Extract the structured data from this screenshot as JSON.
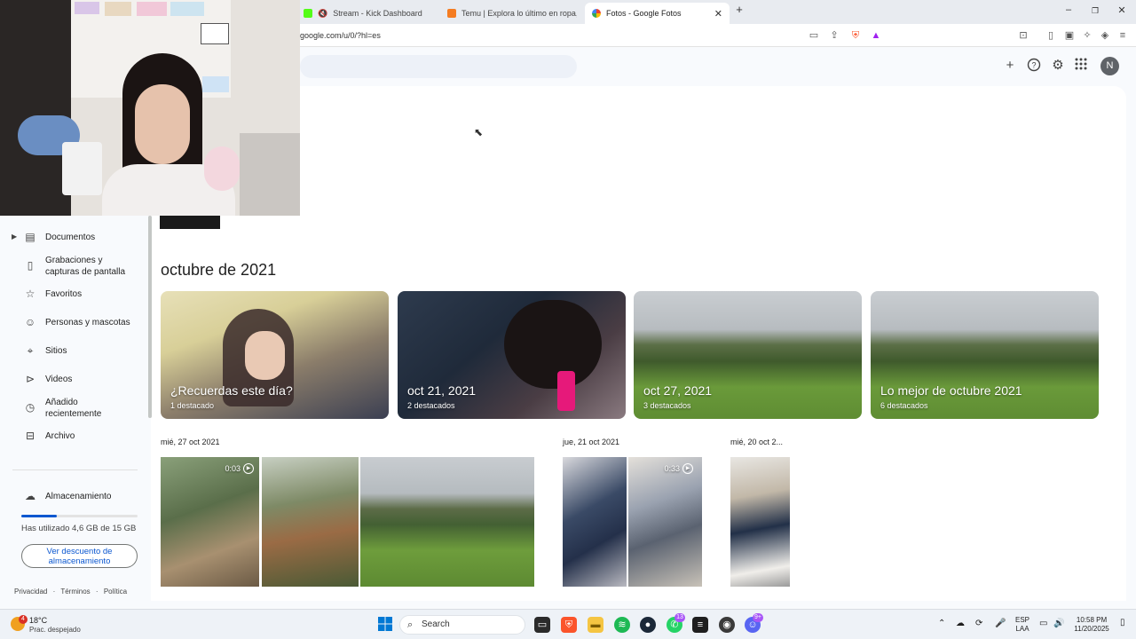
{
  "browser": {
    "tabs": [
      {
        "title": "Stream - Kick Dashboard",
        "active": false
      },
      {
        "title": "Temu | Explora lo último en ropa, be",
        "active": false
      },
      {
        "title": "Fotos - Google Fotos",
        "active": true
      }
    ],
    "url": "google.com/u/0/?hl=es"
  },
  "header": {
    "avatar_initial": "N"
  },
  "sidebar": {
    "items": [
      {
        "label": "Documentos",
        "icon": "document-icon"
      },
      {
        "label": "Grabaciones y capturas de pantalla",
        "icon": "screen-record-icon"
      },
      {
        "label": "Favoritos",
        "icon": "star-icon"
      },
      {
        "label": "Personas y mascotas",
        "icon": "face-icon"
      },
      {
        "label": "Sitios",
        "icon": "location-pin-icon"
      },
      {
        "label": "Videos",
        "icon": "play-icon"
      },
      {
        "label": "Añadido recientemente",
        "icon": "clock-icon"
      },
      {
        "label": "Archivo",
        "icon": "archive-icon"
      }
    ],
    "storage": {
      "label": "Almacenamiento",
      "used_text": "Has utilizado 4,6 GB de 15 GB",
      "used_fraction": 0.307,
      "button": "Ver descuento de almacenamiento"
    },
    "footer": [
      "Privacidad",
      "Términos",
      "Política"
    ]
  },
  "main": {
    "section_title": "octubre de 2021",
    "highlights": [
      {
        "title": "¿Recuerdas este día?",
        "subtitle": "1 destacado"
      },
      {
        "title": "oct 21, 2021",
        "subtitle": "2 destacados"
      },
      {
        "title": "oct 27, 2021",
        "subtitle": "3 destacados"
      },
      {
        "title": "Lo mejor de octubre 2021",
        "subtitle": "6 destacados"
      }
    ],
    "date_groups": [
      {
        "date": "mié, 27 oct 2021"
      },
      {
        "date": "jue, 21 oct 2021"
      },
      {
        "date": "mié, 20 oct 2..."
      }
    ],
    "video_durations": [
      "0:03",
      "0:33"
    ]
  },
  "taskbar": {
    "weather_temp": "18°C",
    "weather_desc": "Prac. despejado",
    "search_placeholder": "Search",
    "lang_line1": "ESP",
    "lang_line2": "LAA",
    "time": "10:58 PM",
    "date": "11/20/2025",
    "badges": {
      "whatsapp": "13",
      "discord": "9+"
    }
  }
}
